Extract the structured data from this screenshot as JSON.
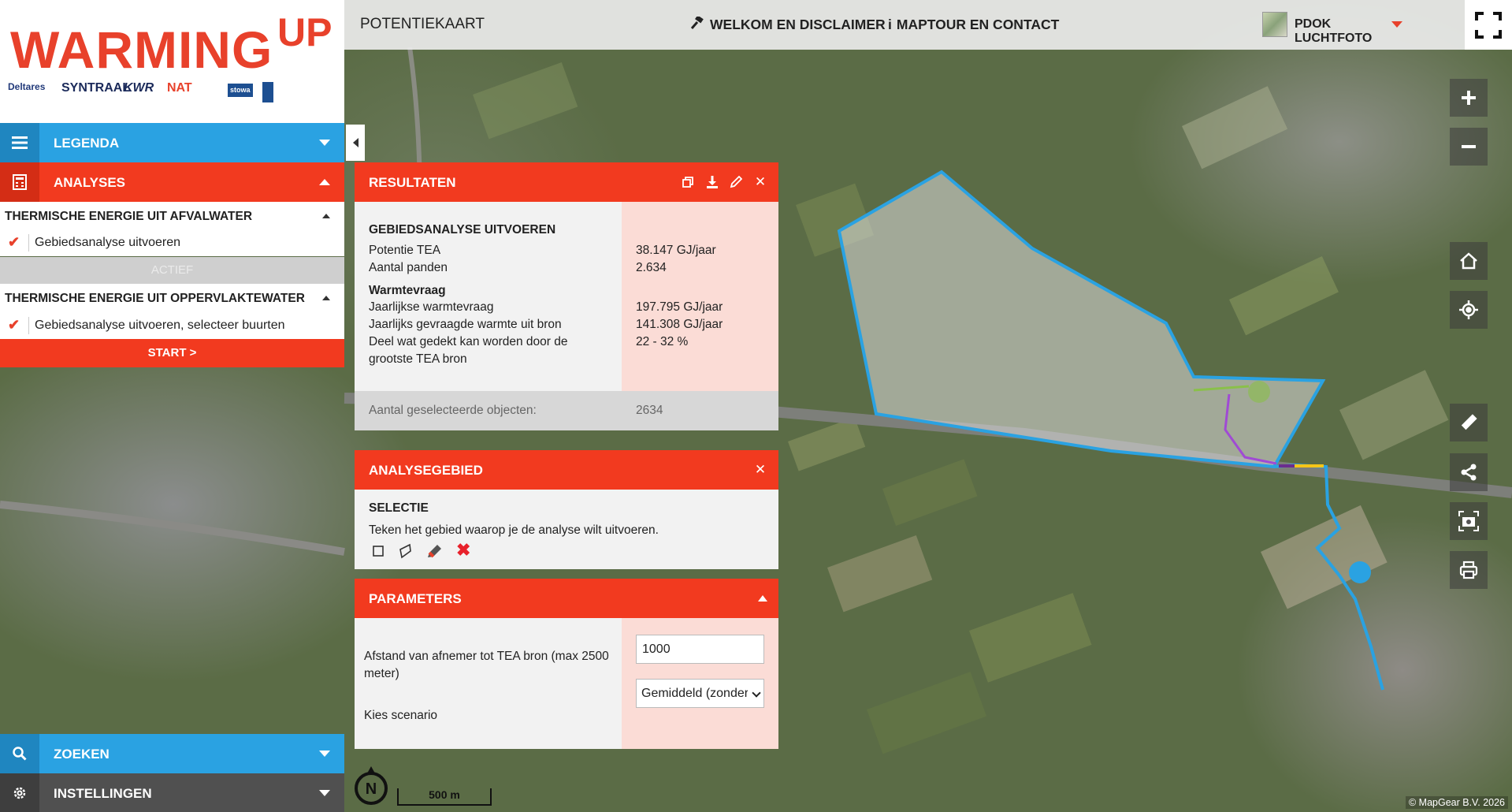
{
  "logo": {
    "word": "WARMING",
    "up": "UP",
    "partners": [
      "Deltares",
      "SYNTRAAL",
      "KWR",
      "NAT",
      "stowa"
    ]
  },
  "menu": {
    "legenda": "LEGENDA",
    "analyses": "ANALYSES",
    "zoeken": "ZOEKEN",
    "instellingen": "INSTELLINGEN"
  },
  "analyses": {
    "section1": {
      "title": "THERMISCHE ENERGIE UIT AFVALWATER",
      "item": "Gebiedsanalyse uitvoeren",
      "status": "ACTIEF"
    },
    "section2": {
      "title": "THERMISCHE ENERGIE UIT OPPERVLAKTEWATER",
      "item": "Gebiedsanalyse uitvoeren, selecteer buurten"
    },
    "start": "START >"
  },
  "topbar": {
    "title": "POTENTIEKAART",
    "welcome": "WELKOM EN DISCLAIMER",
    "maptour": "MAPTOUR EN CONTACT",
    "basemap": "PDOK LUCHTFOTO"
  },
  "resultaten": {
    "title": "RESULTATEN",
    "subtitle": "GEBIEDSANALYSE UITVOEREN",
    "rows": [
      {
        "label": "Potentie TEA",
        "value": "38.147 GJ/jaar"
      },
      {
        "label": "Aantal panden",
        "value": "2.634"
      }
    ],
    "warmtevraag_heading": "Warmtevraag",
    "warmtevraag": [
      {
        "label": "Jaarlijkse warmtevraag",
        "value": "197.795 GJ/jaar"
      },
      {
        "label": "Jaarlijks gevraagde warmte uit bron",
        "value": "141.308 GJ/jaar"
      },
      {
        "label": "Deel wat gedekt kan worden door de grootste TEA bron",
        "value": "22 - 32 %"
      }
    ],
    "footer_label": "Aantal geselecteerde objecten:",
    "footer_value": "2634"
  },
  "analysegebied": {
    "title": "ANALYSEGEBIED",
    "subtitle": "SELECTIE",
    "text": "Teken het gebied waarop je de analyse wilt uitvoeren."
  },
  "parameters": {
    "title": "PARAMETERS",
    "afstand_label": "Afstand van afnemer tot TEA bron (max 2500 meter)",
    "afstand_value": "1000",
    "scenario_label": "Kies scenario",
    "scenario_value": "Gemiddeld (zonder"
  },
  "map": {
    "scale": "500 m",
    "north": "N",
    "copyright": "© MapGear B.V. 2026",
    "colors": {
      "polygon": "#2aa2e2",
      "accent": "#f23a1f"
    }
  }
}
